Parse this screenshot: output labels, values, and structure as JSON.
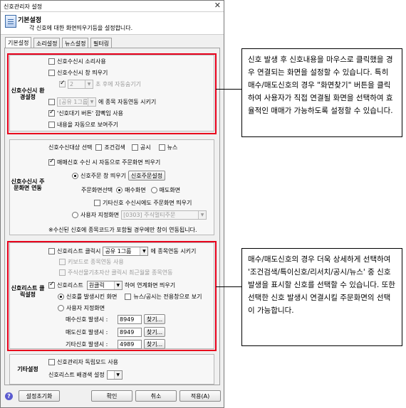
{
  "window": {
    "title": "신호관리자 설정",
    "close": "✕"
  },
  "header": {
    "title": "기본설정",
    "description": "각 신호에 대한 화면띄우기등을 설정합니다."
  },
  "tabs": [
    "기본설정",
    "소리설정",
    "뉴스설정",
    "필터링"
  ],
  "group1": {
    "label": "신호수신시 환경설정",
    "sound": "신호수신시 소리사용",
    "window_pop": "신호수신시 창 띄우기",
    "auto_hide_value": "2",
    "auto_hide_label": "초 후에 자동숨기기",
    "link_combo": "[공유 1그룹",
    "link_label": "에 종목 자동연동 시키기",
    "blink": "'신호대기 버튼' 깜빡임 사용",
    "auto_view": "내용을 자동으로 보여주기"
  },
  "group2": {
    "label": "신호수신시 주문화면 연동",
    "target_label": "신호수신대상 선택",
    "cond_search": "조건검색",
    "notice": "공시",
    "news": "뉴스",
    "auto_open": "매매신호 수신 시 자동으로 주문화면 띄우기",
    "order_window": "신호주문 창 띄우기",
    "order_setting_btn": "신호주문설정",
    "screen_select": "주문화면선택",
    "buy_screen": "매수화면",
    "sell_screen": "매도화면",
    "other_signal": "기타신호 수신시에도 주문화면 띄우기",
    "user_screen": "사용자 지정화면",
    "user_screen_combo": "[0303] 주식멀티주문",
    "note": "※수신된 신호에 종목코드가 포함될 경우에만 창이 연동됩니다."
  },
  "group3": {
    "label": "신호리스트 클릭설정",
    "click_link": "신호리스트 클릭시",
    "click_combo": "공유 1그룹",
    "click_link_suffix": "에 종목연동 시키기",
    "keyboard": "키보드로 종목연동 사용",
    "futures_recent": "주식선물기초자산 클릭시 최근월물 종목연동",
    "signal_list": "신호리스트",
    "click_type": "원클릭",
    "linked_screen": "하여 연계화면 띄우기",
    "signal_screen": "신호를 발생시킨 화면",
    "news_special": "뉴스/공시는 전용창으로 보기",
    "user_screen": "사용자 지정화면",
    "buy_signal_label": "매수신호 발생시 :",
    "buy_signal_value": "8949",
    "sell_signal_label": "매도신호 발생시 :",
    "sell_signal_value": "8949",
    "etc_signal_label": "기타신호 발생시 :",
    "etc_signal_value": "4989",
    "find_btn": "찾기..."
  },
  "group4": {
    "label": "기타설정",
    "standalone": "신호관리자 독립모드 사용",
    "bg_color_label": "신호리스트 배경색 설정"
  },
  "footer": {
    "reset": "설정초기화",
    "ok": "확인",
    "cancel": "취소",
    "apply": "적용(A)",
    "help": "?"
  },
  "callouts": {
    "top": "신호 발생 후 신호내용을 마우스로 클릭했을 경우 연결되는 화면을 설정할 수 있습니다. 특히 매수/매도신호의 경우 \"화면찾기\" 버튼을 클릭하여 사용자가 직접 연결될 화면을 선택하여 효율적인 매매가 가능하도록 설정할 수 있습니다.",
    "bottom": "매수/매도신호의 경우 더욱 상세하게 선택하여 '조건검색/특이신호/리서치/공시/뉴스' 중 신호발생을 표시할 신호를 선택할 수 있습니다. 또한 선택한 신호 발생시 연결시킬 주문화면의 선택이 가능합니다."
  },
  "colors": {
    "highlight": "#e8001c"
  }
}
